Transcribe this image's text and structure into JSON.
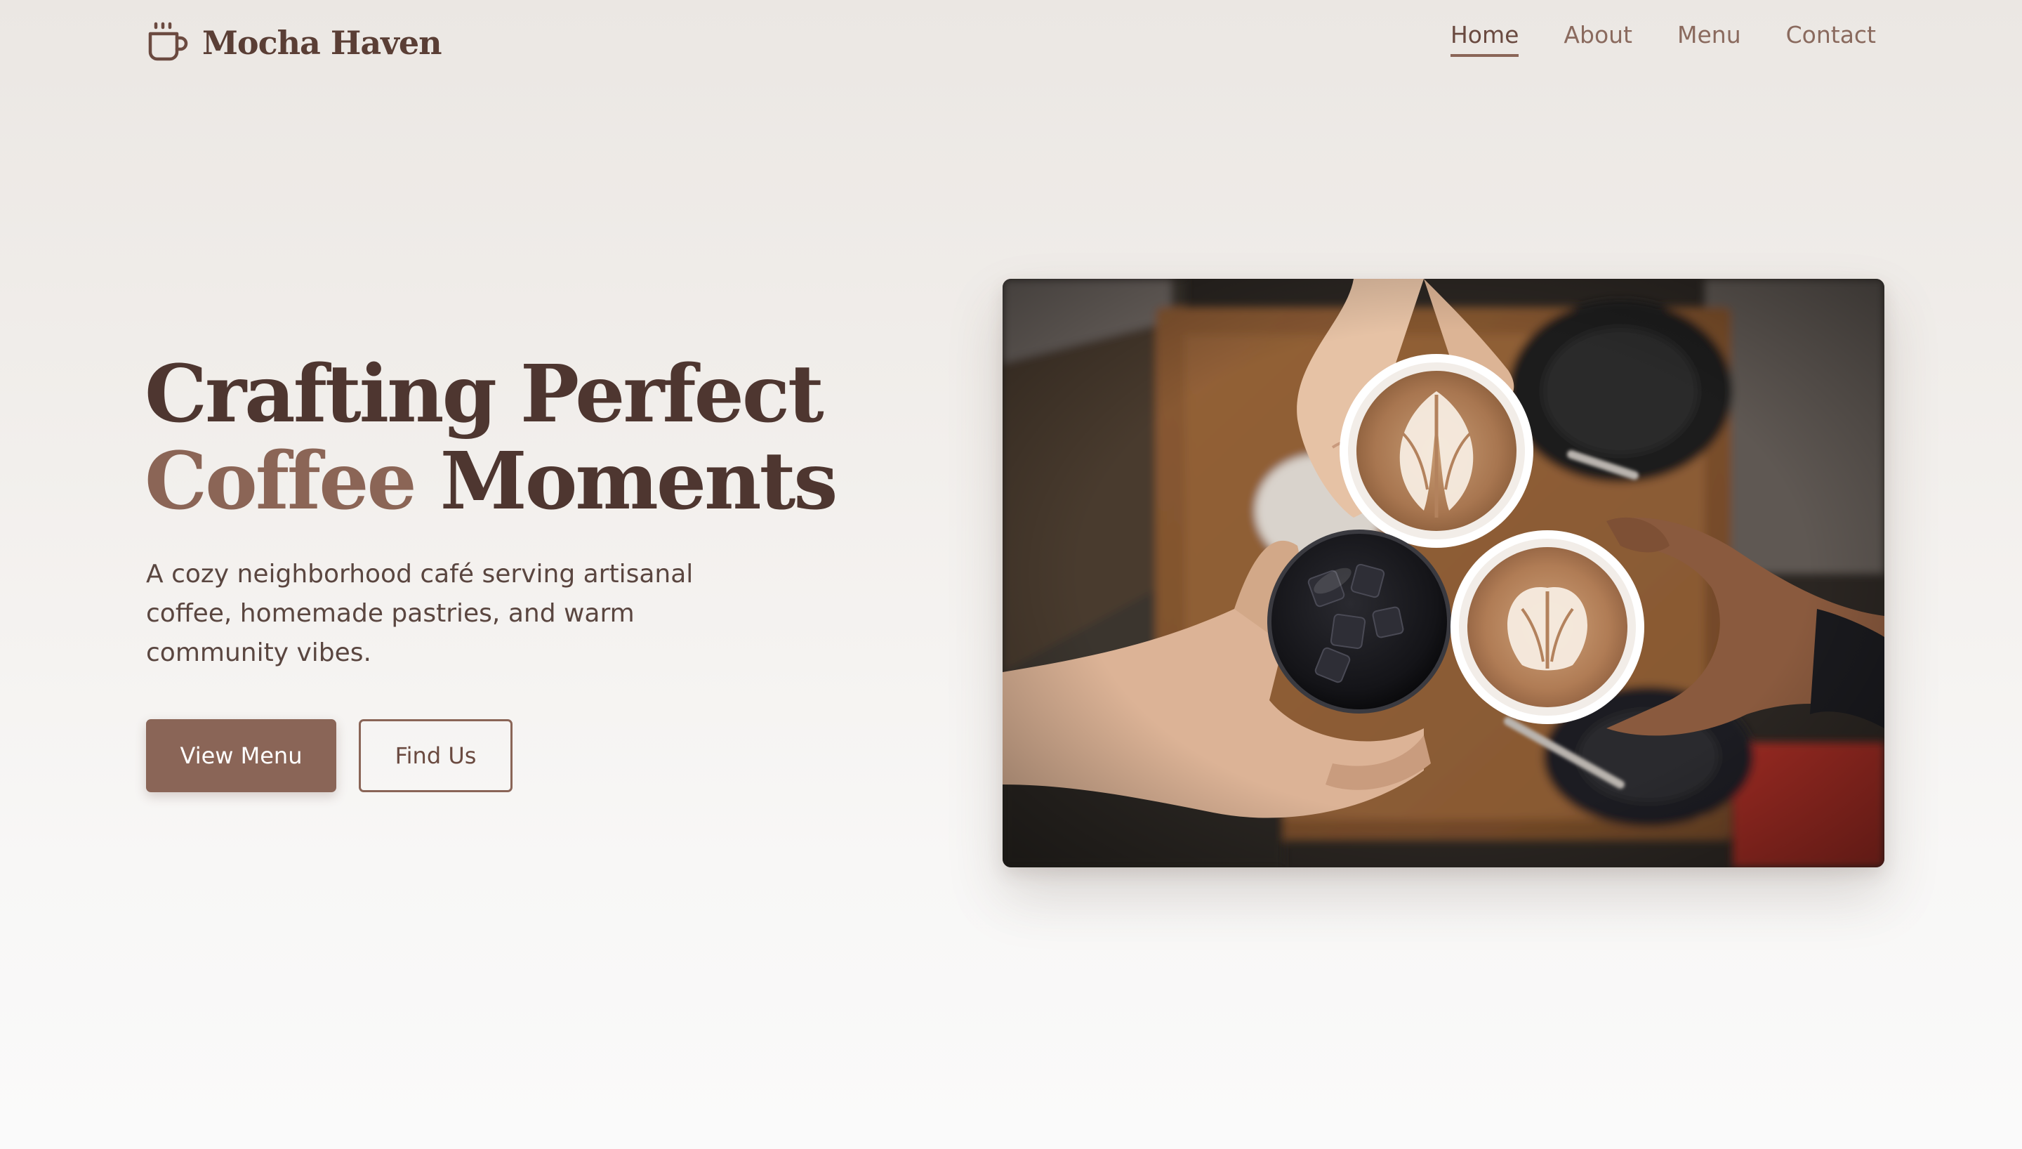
{
  "header": {
    "logo_text": "Mocha Haven",
    "logo_icon": "coffee-cup-icon"
  },
  "nav": {
    "items": [
      {
        "label": "Home",
        "active": true
      },
      {
        "label": "About",
        "active": false
      },
      {
        "label": "Menu",
        "active": false
      },
      {
        "label": "Contact",
        "active": false
      }
    ]
  },
  "hero": {
    "title_line1": "Crafting Perfect",
    "title_accent": "Coffee",
    "title_line2_rest": " Moments",
    "subtitle": "A cozy neighborhood café serving artisanal coffee, homemade pastries, and warm community vibes.",
    "primary_button": "View Menu",
    "secondary_button": "Find Us"
  },
  "colors": {
    "brand_dark": "#4e3630",
    "brand_accent": "#8b6556",
    "nav_text": "#8a6a5e"
  }
}
